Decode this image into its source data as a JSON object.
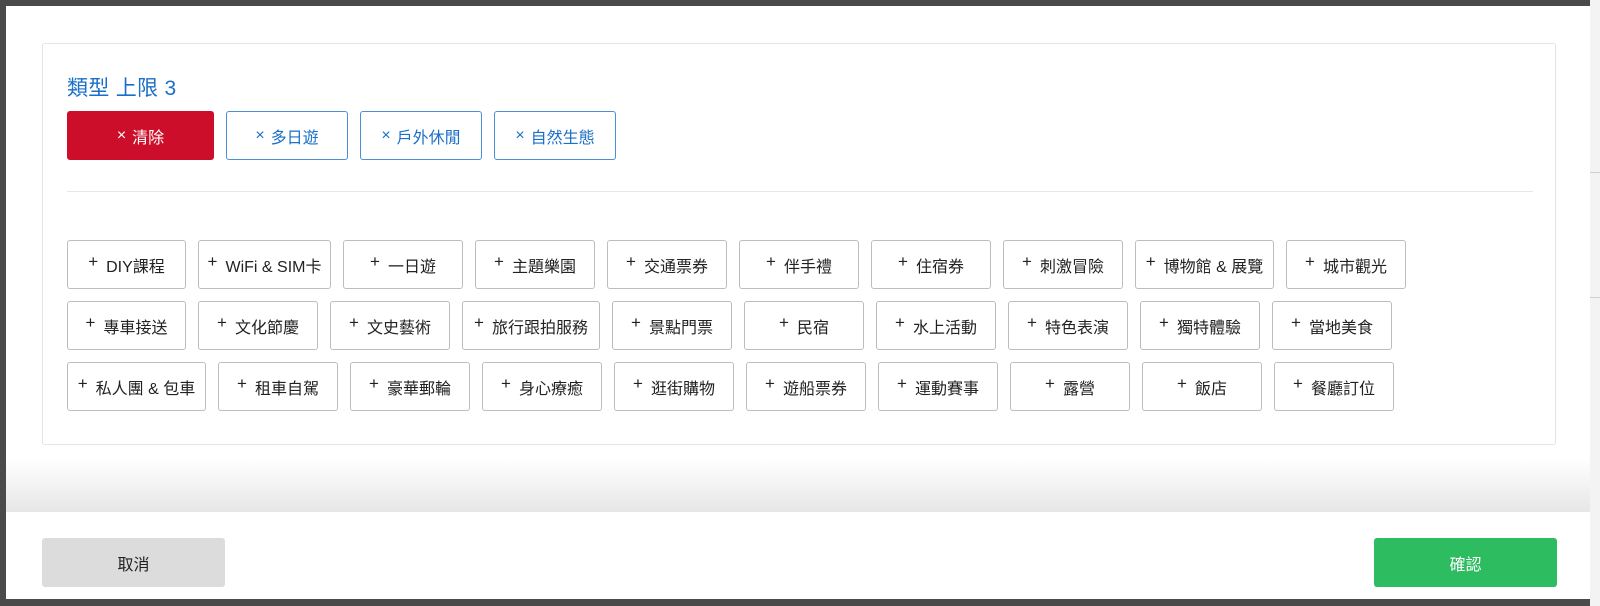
{
  "filter": {
    "title": "類型 上限 3",
    "clear_label": "清除",
    "remove_glyph": "×",
    "add_glyph": "+",
    "selected": [
      {
        "label": "多日遊"
      },
      {
        "label": "戶外休閒"
      },
      {
        "label": "自然生態"
      }
    ],
    "options_rows": [
      [
        {
          "label": "DIY課程"
        },
        {
          "label": "WiFi & SIM卡"
        },
        {
          "label": "一日遊"
        },
        {
          "label": "主題樂園"
        },
        {
          "label": "交通票券"
        },
        {
          "label": "伴手禮"
        },
        {
          "label": "住宿券"
        },
        {
          "label": "刺激冒險"
        },
        {
          "label": "博物館 & 展覽"
        },
        {
          "label": "城市觀光"
        }
      ],
      [
        {
          "label": "專車接送"
        },
        {
          "label": "文化節慶"
        },
        {
          "label": "文史藝術"
        },
        {
          "label": "旅行跟拍服務"
        },
        {
          "label": "景點門票"
        },
        {
          "label": "民宿"
        },
        {
          "label": "水上活動"
        },
        {
          "label": "特色表演"
        },
        {
          "label": "獨特體驗"
        },
        {
          "label": "當地美食"
        }
      ],
      [
        {
          "label": "私人團 & 包車"
        },
        {
          "label": "租車自駕"
        },
        {
          "label": "豪華郵輪"
        },
        {
          "label": "身心療癒"
        },
        {
          "label": "逛街購物"
        },
        {
          "label": "遊船票券"
        },
        {
          "label": "運動賽事"
        },
        {
          "label": "露營"
        },
        {
          "label": "飯店"
        },
        {
          "label": "餐廳訂位"
        }
      ]
    ]
  },
  "footer": {
    "cancel_label": "取消",
    "confirm_label": "確認"
  },
  "colors": {
    "title_blue": "#1a6fc6",
    "clear_red": "#cc0e2a",
    "confirm_green": "#2dbc5f",
    "cancel_gray": "#dcdcdc"
  }
}
